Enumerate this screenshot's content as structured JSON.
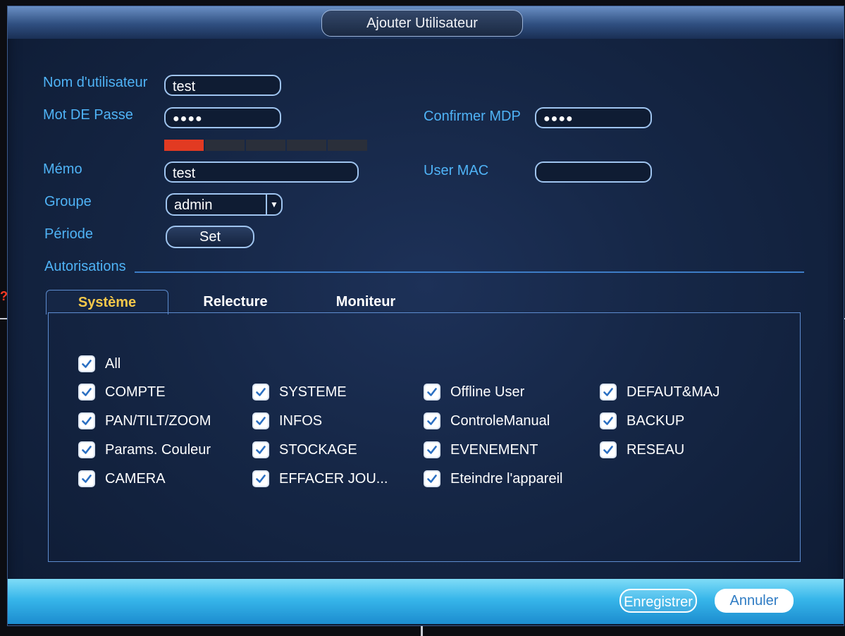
{
  "dialog": {
    "title": "Ajouter Utilisateur"
  },
  "form": {
    "username_label": "Nom d'utilisateur",
    "username_value": "test",
    "password_label": "Mot DE Passe",
    "password_value": "●●●●",
    "password_strength_level": 0.2,
    "confirm_label": "Confirmer MDP",
    "confirm_value": "●●●●",
    "memo_label": "Mémo",
    "memo_value": "test",
    "user_mac_label": "User MAC",
    "user_mac_value": "",
    "group_label": "Groupe",
    "group_value": "admin",
    "period_label": "Période",
    "period_button": "Set"
  },
  "permissions": {
    "section_label": "Autorisations",
    "tabs": [
      {
        "label": "Système",
        "active": true
      },
      {
        "label": "Relecture",
        "active": false
      },
      {
        "label": "Moniteur",
        "active": false
      }
    ],
    "all": {
      "label": "All",
      "checked": true
    },
    "items": [
      {
        "label": "COMPTE",
        "checked": true
      },
      {
        "label": "SYSTEME",
        "checked": true
      },
      {
        "label": "Offline User",
        "checked": true
      },
      {
        "label": "DEFAUT&MAJ",
        "checked": true
      },
      {
        "label": "PAN/TILT/ZOOM",
        "checked": true
      },
      {
        "label": "INFOS",
        "checked": true
      },
      {
        "label": "ControleManual",
        "checked": true
      },
      {
        "label": "BACKUP",
        "checked": true
      },
      {
        "label": "Params. Couleur",
        "checked": true
      },
      {
        "label": "STOCKAGE",
        "checked": true
      },
      {
        "label": "EVENEMENT",
        "checked": true
      },
      {
        "label": "RESEAU",
        "checked": true
      },
      {
        "label": "CAMERA",
        "checked": true
      },
      {
        "label": "EFFACER JOU...",
        "checked": true
      },
      {
        "label": "Eteindre l'appareil",
        "checked": true
      }
    ]
  },
  "footer": {
    "save_label": "Enregistrer",
    "cancel_label": "Annuler"
  },
  "background": {
    "edge_mark": "?"
  },
  "colors": {
    "label_blue": "#4fb3f6",
    "active_tab": "#f5c84a",
    "strength_red": "#e23a22"
  }
}
